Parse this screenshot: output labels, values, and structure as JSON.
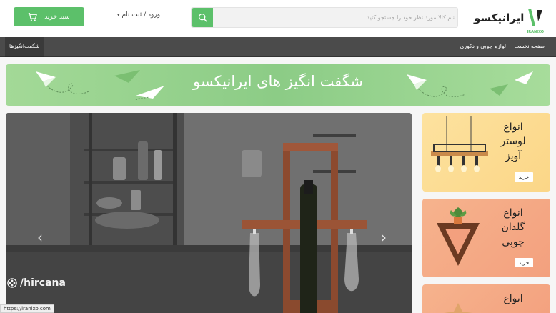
{
  "header": {
    "cart_label": "سبد خرید",
    "login_label": "ورود / ثبت نام",
    "search_placeholder": "نام کالا مورد نظر خود را جستجو کنید...",
    "logo_text": "ایرانیکسو",
    "logo_sub": "IRANIXO"
  },
  "nav": {
    "items": [
      {
        "label": "صفحه نخست"
      },
      {
        "label": "لوازم چوبی و دکوری"
      }
    ],
    "wow_label": "شگفت‌انگیزها"
  },
  "banner": {
    "title": "شگفت انگیز های ایرانیکسو"
  },
  "slider": {
    "watermark": "/hircana",
    "prev_icon": "chevron-left-icon",
    "next_icon": "chevron-right-icon"
  },
  "cards": [
    {
      "title": "انواع لوستر آویز",
      "buy": "خرید"
    },
    {
      "title": "انواع گلدان چوبی",
      "buy": "خرید"
    },
    {
      "title": "انواع"
    }
  ],
  "status_bar": {
    "url": "https://iranixo.com"
  },
  "colors": {
    "accent": "#5cc06a",
    "nav_bg": "#4b4b4b",
    "banner_green": "#8ccc86",
    "card_yellow": "#fde29f",
    "card_orange": "#f6b38d"
  }
}
